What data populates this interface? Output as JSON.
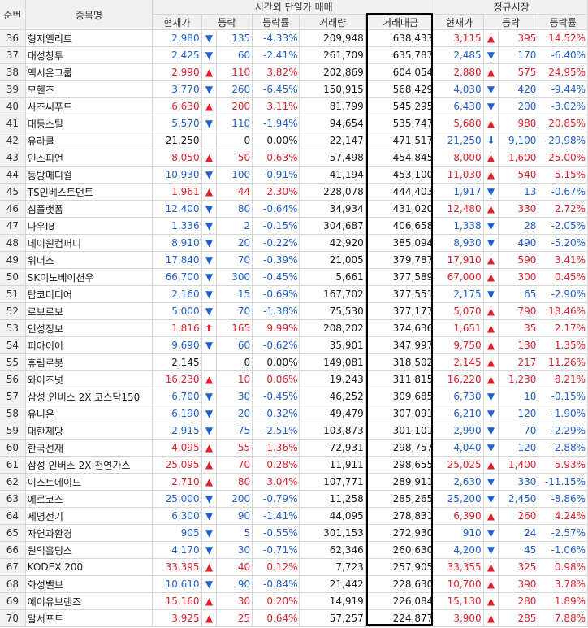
{
  "headers": {
    "rank": "순번",
    "name": "종목명",
    "after_hours_group": "시간외 단일가 매매",
    "regular_group": "정규시장",
    "cols": [
      "현재가",
      "등락",
      "등락률",
      "거래량",
      "거래대금",
      "현재가",
      "등락",
      "등락률"
    ]
  },
  "rows": [
    {
      "rank": "36",
      "name": "형지엘리트",
      "p": "2,980",
      "pc": "down",
      "sym": "▼",
      "ch": "135",
      "rate": "-4.33%",
      "vol": "209,948",
      "amt": "638,433",
      "rp": "3,115",
      "rpc": "up",
      "rsym": "▲",
      "rch": "395",
      "rrate": "14.52%"
    },
    {
      "rank": "37",
      "name": "대성창투",
      "p": "2,425",
      "pc": "down",
      "sym": "▼",
      "ch": "60",
      "rate": "-2.41%",
      "vol": "261,709",
      "amt": "635,787",
      "rp": "2,485",
      "rpc": "down",
      "rsym": "▼",
      "rch": "170",
      "rrate": "-6.40%"
    },
    {
      "rank": "38",
      "name": "엑시온그룹",
      "p": "2,990",
      "pc": "up",
      "sym": "▲",
      "ch": "110",
      "rate": "3.82%",
      "vol": "202,869",
      "amt": "604,054",
      "rp": "2,880",
      "rpc": "up",
      "rsym": "▲",
      "rch": "575",
      "rrate": "24.95%"
    },
    {
      "rank": "39",
      "name": "모헨즈",
      "p": "3,770",
      "pc": "down",
      "sym": "▼",
      "ch": "260",
      "rate": "-6.45%",
      "vol": "150,915",
      "amt": "568,429",
      "rp": "4,030",
      "rpc": "down",
      "rsym": "▼",
      "rch": "420",
      "rrate": "-9.44%"
    },
    {
      "rank": "40",
      "name": "사조씨푸드",
      "p": "6,630",
      "pc": "up",
      "sym": "▲",
      "ch": "200",
      "rate": "3.11%",
      "vol": "81,799",
      "amt": "545,295",
      "rp": "6,430",
      "rpc": "down",
      "rsym": "▼",
      "rch": "200",
      "rrate": "-3.02%"
    },
    {
      "rank": "41",
      "name": "대동스틸",
      "p": "5,570",
      "pc": "down",
      "sym": "▼",
      "ch": "110",
      "rate": "-1.94%",
      "vol": "94,654",
      "amt": "535,747",
      "rp": "5,680",
      "rpc": "up",
      "rsym": "▲",
      "rch": "980",
      "rrate": "20.85%"
    },
    {
      "rank": "42",
      "name": "유라클",
      "p": "21,250",
      "pc": "flat",
      "sym": "",
      "ch": "0",
      "rate": "0.00%",
      "vol": "22,147",
      "amt": "471,517",
      "rp": "21,250",
      "rpc": "down",
      "rsym": "⬇",
      "rch": "9,100",
      "rrate": "-29.98%"
    },
    {
      "rank": "43",
      "name": "인스피언",
      "p": "8,050",
      "pc": "up",
      "sym": "▲",
      "ch": "50",
      "rate": "0.63%",
      "vol": "57,498",
      "amt": "454,845",
      "rp": "8,000",
      "rpc": "up",
      "rsym": "▲",
      "rch": "1,600",
      "rrate": "25.00%"
    },
    {
      "rank": "44",
      "name": "동방메디컬",
      "p": "10,930",
      "pc": "down",
      "sym": "▼",
      "ch": "100",
      "rate": "-0.91%",
      "vol": "41,194",
      "amt": "453,100",
      "rp": "11,030",
      "rpc": "up",
      "rsym": "▲",
      "rch": "540",
      "rrate": "5.15%"
    },
    {
      "rank": "45",
      "name": "TS인베스트먼트",
      "p": "1,961",
      "pc": "up",
      "sym": "▲",
      "ch": "44",
      "rate": "2.30%",
      "vol": "228,078",
      "amt": "444,403",
      "rp": "1,917",
      "rpc": "down",
      "rsym": "▼",
      "rch": "13",
      "rrate": "-0.67%"
    },
    {
      "rank": "46",
      "name": "심플랫폼",
      "p": "12,400",
      "pc": "down",
      "sym": "▼",
      "ch": "80",
      "rate": "-0.64%",
      "vol": "34,934",
      "amt": "431,020",
      "rp": "12,480",
      "rpc": "up",
      "rsym": "▲",
      "rch": "330",
      "rrate": "2.72%"
    },
    {
      "rank": "47",
      "name": "나우IB",
      "p": "1,336",
      "pc": "down",
      "sym": "▼",
      "ch": "2",
      "rate": "-0.15%",
      "vol": "304,687",
      "amt": "406,658",
      "rp": "1,338",
      "rpc": "down",
      "rsym": "▼",
      "rch": "28",
      "rrate": "-2.05%"
    },
    {
      "rank": "48",
      "name": "데이원컴퍼니",
      "p": "8,910",
      "pc": "down",
      "sym": "▼",
      "ch": "20",
      "rate": "-0.22%",
      "vol": "42,920",
      "amt": "385,094",
      "rp": "8,930",
      "rpc": "down",
      "rsym": "▼",
      "rch": "490",
      "rrate": "-5.20%"
    },
    {
      "rank": "49",
      "name": "위너스",
      "p": "17,840",
      "pc": "down",
      "sym": "▼",
      "ch": "70",
      "rate": "-0.39%",
      "vol": "21,005",
      "amt": "379,787",
      "rp": "17,910",
      "rpc": "up",
      "rsym": "▲",
      "rch": "590",
      "rrate": "3.41%"
    },
    {
      "rank": "50",
      "name": "SK이노베이션우",
      "p": "66,700",
      "pc": "down",
      "sym": "▼",
      "ch": "300",
      "rate": "-0.45%",
      "vol": "5,661",
      "amt": "377,589",
      "rp": "67,000",
      "rpc": "up",
      "rsym": "▲",
      "rch": "300",
      "rrate": "0.45%"
    },
    {
      "rank": "51",
      "name": "탑코미디어",
      "p": "2,160",
      "pc": "down",
      "sym": "▼",
      "ch": "15",
      "rate": "-0.69%",
      "vol": "167,702",
      "amt": "377,551",
      "rp": "2,175",
      "rpc": "down",
      "rsym": "▼",
      "rch": "65",
      "rrate": "-2.90%"
    },
    {
      "rank": "52",
      "name": "로보로보",
      "p": "5,000",
      "pc": "down",
      "sym": "▼",
      "ch": "70",
      "rate": "-1.38%",
      "vol": "75,530",
      "amt": "377,177",
      "rp": "5,070",
      "rpc": "up",
      "rsym": "▲",
      "rch": "790",
      "rrate": "18.46%"
    },
    {
      "rank": "53",
      "name": "인성정보",
      "p": "1,816",
      "pc": "up",
      "sym": "⬆",
      "ch": "165",
      "rate": "9.99%",
      "vol": "208,202",
      "amt": "374,636",
      "rp": "1,651",
      "rpc": "up",
      "rsym": "▲",
      "rch": "35",
      "rrate": "2.17%"
    },
    {
      "rank": "54",
      "name": "피아이이",
      "p": "9,690",
      "pc": "down",
      "sym": "▼",
      "ch": "60",
      "rate": "-0.62%",
      "vol": "35,901",
      "amt": "347,997",
      "rp": "9,750",
      "rpc": "up",
      "rsym": "▲",
      "rch": "130",
      "rrate": "1.35%"
    },
    {
      "rank": "55",
      "name": "휴림로봇",
      "p": "2,145",
      "pc": "flat",
      "sym": "",
      "ch": "0",
      "rate": "0.00%",
      "vol": "149,081",
      "amt": "318,502",
      "rp": "2,145",
      "rpc": "up",
      "rsym": "▲",
      "rch": "217",
      "rrate": "11.26%"
    },
    {
      "rank": "56",
      "name": "와이즈넛",
      "p": "16,230",
      "pc": "up",
      "sym": "▲",
      "ch": "10",
      "rate": "0.06%",
      "vol": "19,243",
      "amt": "311,815",
      "rp": "16,220",
      "rpc": "up",
      "rsym": "▲",
      "rch": "1,230",
      "rrate": "8.21%"
    },
    {
      "rank": "57",
      "name": "삼성 인버스 2X 코스닥150",
      "p": "6,700",
      "pc": "down",
      "sym": "▼",
      "ch": "30",
      "rate": "-0.45%",
      "vol": "46,252",
      "amt": "309,685",
      "rp": "6,730",
      "rpc": "down",
      "rsym": "▼",
      "rch": "10",
      "rrate": "-0.15%"
    },
    {
      "rank": "58",
      "name": "유니온",
      "p": "6,190",
      "pc": "down",
      "sym": "▼",
      "ch": "20",
      "rate": "-0.32%",
      "vol": "49,479",
      "amt": "307,091",
      "rp": "6,210",
      "rpc": "down",
      "rsym": "▼",
      "rch": "120",
      "rrate": "-1.90%"
    },
    {
      "rank": "59",
      "name": "대한제당",
      "p": "2,915",
      "pc": "down",
      "sym": "▼",
      "ch": "75",
      "rate": "-2.51%",
      "vol": "103,873",
      "amt": "301,101",
      "rp": "2,990",
      "rpc": "down",
      "rsym": "▼",
      "rch": "70",
      "rrate": "-2.29%"
    },
    {
      "rank": "60",
      "name": "한국선재",
      "p": "4,095",
      "pc": "up",
      "sym": "▲",
      "ch": "55",
      "rate": "1.36%",
      "vol": "72,931",
      "amt": "298,757",
      "rp": "4,040",
      "rpc": "down",
      "rsym": "▼",
      "rch": "120",
      "rrate": "-2.88%"
    },
    {
      "rank": "61",
      "name": "삼성 인버스 2X 천연가스",
      "p": "25,095",
      "pc": "up",
      "sym": "▲",
      "ch": "70",
      "rate": "0.28%",
      "vol": "11,911",
      "amt": "298,655",
      "rp": "25,025",
      "rpc": "up",
      "rsym": "▲",
      "rch": "1,400",
      "rrate": "5.93%"
    },
    {
      "rank": "62",
      "name": "이스트에이드",
      "p": "2,710",
      "pc": "up",
      "sym": "▲",
      "ch": "80",
      "rate": "3.04%",
      "vol": "107,771",
      "amt": "289,911",
      "rp": "2,630",
      "rpc": "down",
      "rsym": "▼",
      "rch": "330",
      "rrate": "-11.15%"
    },
    {
      "rank": "63",
      "name": "에르코스",
      "p": "25,000",
      "pc": "down",
      "sym": "▼",
      "ch": "200",
      "rate": "-0.79%",
      "vol": "11,258",
      "amt": "285,265",
      "rp": "25,200",
      "rpc": "down",
      "rsym": "▼",
      "rch": "2,450",
      "rrate": "-8.86%"
    },
    {
      "rank": "64",
      "name": "세명전기",
      "p": "6,300",
      "pc": "down",
      "sym": "▼",
      "ch": "90",
      "rate": "-1.41%",
      "vol": "44,095",
      "amt": "278,831",
      "rp": "6,390",
      "rpc": "up",
      "rsym": "▲",
      "rch": "260",
      "rrate": "4.24%"
    },
    {
      "rank": "65",
      "name": "자연과환경",
      "p": "905",
      "pc": "down",
      "sym": "▼",
      "ch": "5",
      "rate": "-0.55%",
      "vol": "301,153",
      "amt": "272,930",
      "rp": "910",
      "rpc": "down",
      "rsym": "▼",
      "rch": "24",
      "rrate": "-2.57%"
    },
    {
      "rank": "66",
      "name": "원익홀딩스",
      "p": "4,170",
      "pc": "down",
      "sym": "▼",
      "ch": "30",
      "rate": "-0.71%",
      "vol": "62,346",
      "amt": "260,630",
      "rp": "4,200",
      "rpc": "down",
      "rsym": "▼",
      "rch": "45",
      "rrate": "-1.06%"
    },
    {
      "rank": "67",
      "name": "KODEX 200",
      "p": "33,395",
      "pc": "up",
      "sym": "▲",
      "ch": "40",
      "rate": "0.12%",
      "vol": "7,723",
      "amt": "257,905",
      "rp": "33,355",
      "rpc": "up",
      "rsym": "▲",
      "rch": "325",
      "rrate": "0.98%"
    },
    {
      "rank": "68",
      "name": "화성밸브",
      "p": "10,610",
      "pc": "down",
      "sym": "▼",
      "ch": "90",
      "rate": "-0.84%",
      "vol": "21,442",
      "amt": "228,630",
      "rp": "10,700",
      "rpc": "up",
      "rsym": "▲",
      "rch": "390",
      "rrate": "3.78%"
    },
    {
      "rank": "69",
      "name": "에이유브랜즈",
      "p": "15,160",
      "pc": "up",
      "sym": "▲",
      "ch": "30",
      "rate": "0.20%",
      "vol": "14,919",
      "amt": "226,084",
      "rp": "15,130",
      "rpc": "up",
      "rsym": "▲",
      "rch": "280",
      "rrate": "1.89%"
    },
    {
      "rank": "70",
      "name": "알서포트",
      "p": "3,925",
      "pc": "up",
      "sym": "▲",
      "ch": "25",
      "rate": "0.64%",
      "vol": "57,257",
      "amt": "224,877",
      "rp": "3,900",
      "rpc": "up",
      "rsym": "▲",
      "rch": "285",
      "rrate": "7.88%"
    }
  ],
  "colors": {
    "up": "#e0212b",
    "down": "#1f5fd1",
    "flat": "#1a1a1a",
    "header_bg": "#f1f1f1",
    "grid": "#d6d6d6"
  }
}
